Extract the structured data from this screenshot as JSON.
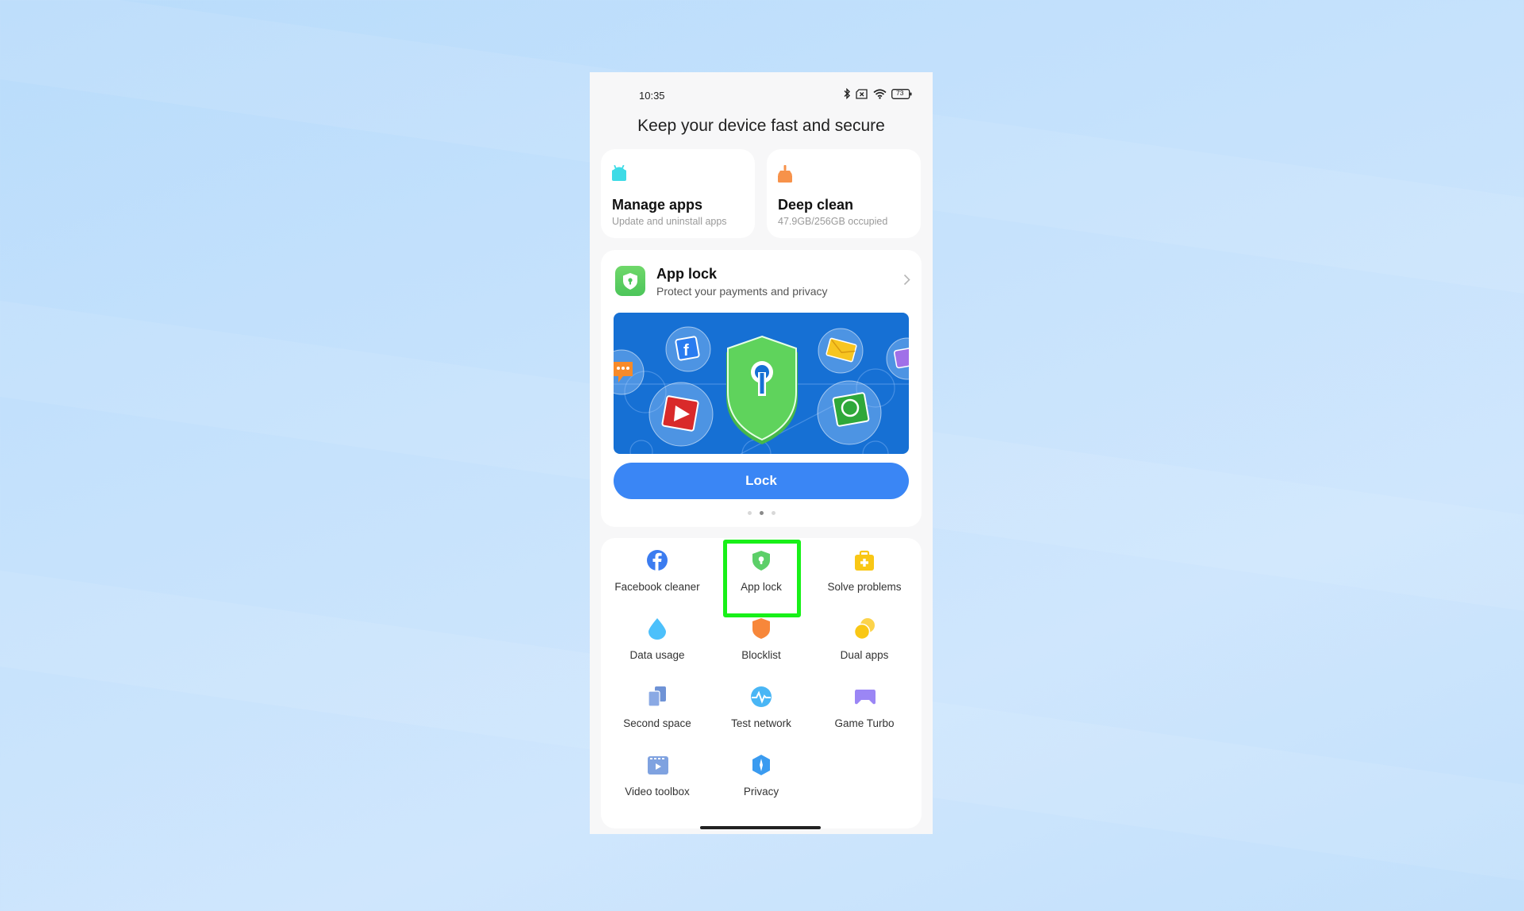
{
  "status_bar": {
    "time": "10:35",
    "icons": [
      "bluetooth-icon",
      "sim-none-icon",
      "wifi-icon",
      "battery-icon"
    ],
    "battery_level": "73"
  },
  "page_title": "Keep your device fast and secure",
  "quick_cards": [
    {
      "icon": "android-icon",
      "title": "Manage apps",
      "subtitle": "Update and uninstall apps",
      "color": "#3ddbe6"
    },
    {
      "icon": "broom-icon",
      "title": "Deep clean",
      "subtitle": "47.9GB/256GB occupied",
      "color": "#f7924a"
    }
  ],
  "app_lock_card": {
    "icon": "shield-lock-icon",
    "title": "App lock",
    "subtitle": "Protect your payments and privacy",
    "banner_icons": [
      "facebook-icon",
      "message-icon",
      "youtube-icon",
      "mail-icon",
      "whatsapp-icon",
      "gallery-icon"
    ],
    "button_label": "Lock",
    "carousel": {
      "count": 3,
      "active_index": 1
    }
  },
  "tools": [
    {
      "label": "Facebook cleaner",
      "icon": "facebook-icon",
      "color": "#3b7cf0"
    },
    {
      "label": "App lock",
      "icon": "shield-lock-icon",
      "color": "#5ccf68",
      "highlighted": true
    },
    {
      "label": "Solve problems",
      "icon": "first-aid-kit-icon",
      "color": "#f9c715"
    },
    {
      "label": "Data usage",
      "icon": "droplet-icon",
      "color": "#4cc0fb"
    },
    {
      "label": "Blocklist",
      "icon": "shield-icon",
      "color": "#f7873a"
    },
    {
      "label": "Dual apps",
      "icon": "dual-circles-icon",
      "color": "#f9c715"
    },
    {
      "label": "Second space",
      "icon": "second-space-icon",
      "color": "#7fa2e0"
    },
    {
      "label": "Test network",
      "icon": "pulse-icon",
      "color": "#49b6f5"
    },
    {
      "label": "Game Turbo",
      "icon": "gamepad-icon",
      "color": "#9b86f5"
    },
    {
      "label": "Video toolbox",
      "icon": "video-toolbox-icon",
      "color": "#7fa2e0"
    },
    {
      "label": "Privacy",
      "icon": "privacy-icon",
      "color": "#3a9bf0"
    }
  ],
  "colors": {
    "accent": "#3a86f5",
    "highlight": "#18f018",
    "banner": "#1670d4"
  }
}
